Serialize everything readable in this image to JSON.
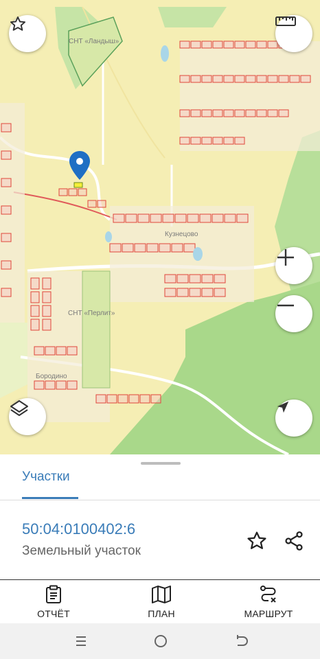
{
  "map": {
    "labels": {
      "snt_top": "СНТ «Ландыш»",
      "kuznetsovo": "Кузнецово",
      "snt_mid": "СНТ «Перлит»",
      "village_bottom": "Бородино"
    },
    "controls": {
      "favorite": "star-icon",
      "measure": "ruler-icon",
      "zoom_in": "plus-icon",
      "zoom_out": "minus-icon",
      "layers": "layers-icon",
      "locate": "navigation-arrow-icon"
    }
  },
  "panel": {
    "tab_label": "Участки",
    "parcel": {
      "cadastral_number": "50:04:0100402:6",
      "type": "Земельный участок"
    },
    "actions": {
      "favorite": "star-outline-icon",
      "share": "share-icon"
    }
  },
  "bottom_nav": {
    "report": "ОТЧЁТ",
    "plan": "ПЛАН",
    "route": "МАРШРУТ"
  },
  "colors": {
    "accent": "#3a7cb8",
    "map_base": "#f5eeb4",
    "forest": "#b8df9a",
    "parcel_outline": "#e0453a",
    "parcel_fill": "#f6c7c2",
    "marker": "#1f6fc4"
  }
}
